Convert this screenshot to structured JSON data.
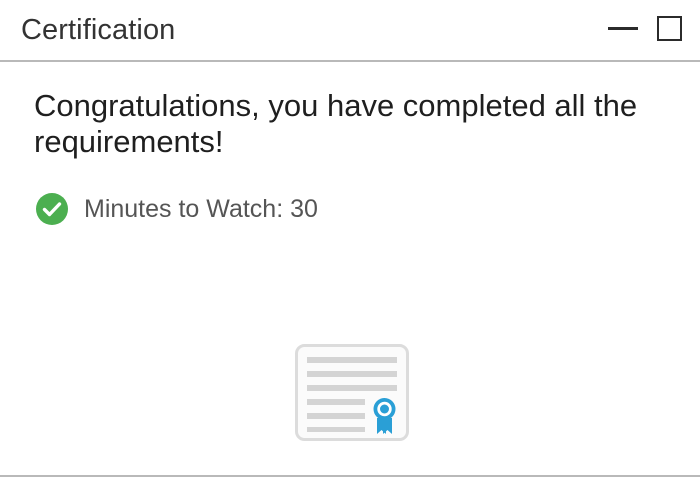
{
  "panel": {
    "title": "Certification"
  },
  "controls": {
    "minimize_icon": "minimize-icon",
    "maximize_icon": "maximize-icon"
  },
  "main": {
    "message": "Congratulations, you have completed all the requirements!",
    "requirements": [
      {
        "label": "Minutes to Watch: 30",
        "status": "complete",
        "icon": "check-circle-icon"
      }
    ],
    "certificate_icon": "certificate-icon"
  },
  "colors": {
    "success_green": "#4caf50",
    "ribbon_blue": "#2a9fd6",
    "certificate_lines": "#d4d4d4"
  }
}
